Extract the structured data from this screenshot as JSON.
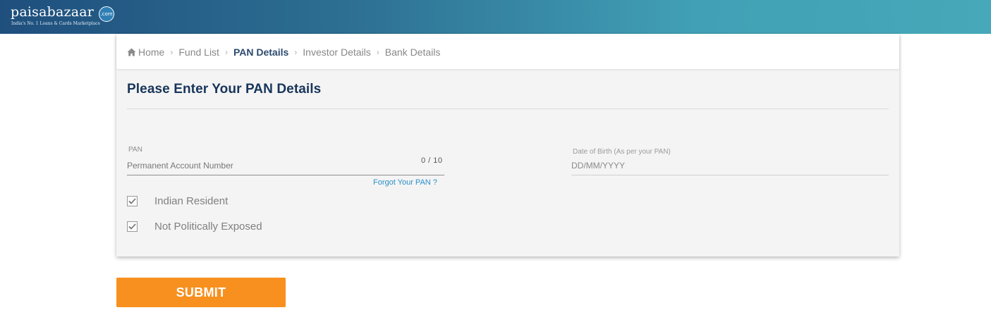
{
  "header": {
    "logo_text": "paisabazaar",
    "logo_badge": ".com",
    "tagline": "India's No. 1 Loans & Cards Marketplace"
  },
  "breadcrumb": {
    "items": [
      {
        "label": "Home",
        "icon": "home-icon",
        "active": false
      },
      {
        "label": "Fund List",
        "active": false
      },
      {
        "label": "PAN Details",
        "active": true
      },
      {
        "label": "Investor Details",
        "active": false
      },
      {
        "label": "Bank Details",
        "active": false
      }
    ]
  },
  "form": {
    "title": "Please Enter Your PAN Details",
    "pan": {
      "label": "PAN",
      "placeholder": "Permanent Account Number",
      "value": "",
      "counter": "0 / 10",
      "forgot_link": "Forgot Your PAN ?"
    },
    "dob": {
      "label": "Date of Birth (As per your PAN)",
      "placeholder": "DD/MM/YYYY",
      "value": ""
    },
    "checkboxes": [
      {
        "label": "Indian Resident",
        "checked": true
      },
      {
        "label": "Not Politically Exposed",
        "checked": true
      }
    ]
  },
  "actions": {
    "submit_label": "SUBMIT"
  },
  "colors": {
    "accent": "#f7901e",
    "link": "#2a8fc9",
    "heading": "#18355a",
    "header_gradient_start": "#1f4f7d",
    "header_gradient_end": "#46a8b9"
  }
}
